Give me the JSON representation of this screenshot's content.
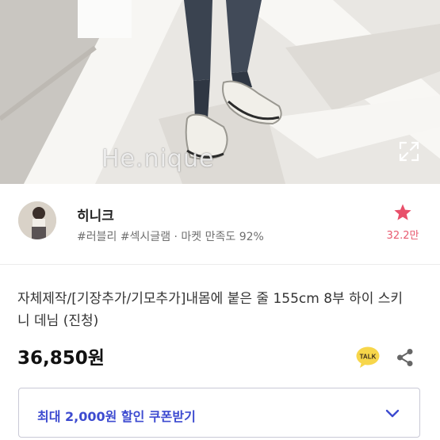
{
  "hero": {
    "brand_watermark": "He.nique",
    "icons": {
      "expand": "expand-icon"
    }
  },
  "seller": {
    "name": "히니크",
    "tags": "#러블리 #섹시글램 · 마켓 만족도 92%",
    "favorite_count": "32.2만",
    "icons": {
      "favorite": "star-icon"
    }
  },
  "product": {
    "title": "자체제작/[기장추가/기모추가]내몸에 붙은 줄 155cm 8부 하이 스키니 데님 (진청)",
    "price": "36,850원",
    "icons": {
      "talk": "kakao-talk-icon",
      "share": "share-icon"
    }
  },
  "coupon": {
    "label": "최대 2,000원 할인 쿠폰받기",
    "icons": {
      "toggle": "chevron-down-icon"
    }
  },
  "colors": {
    "accent_blue": "#3d4bd0",
    "star_red": "#e8506a",
    "talk_yellow": "#f7d64a"
  }
}
